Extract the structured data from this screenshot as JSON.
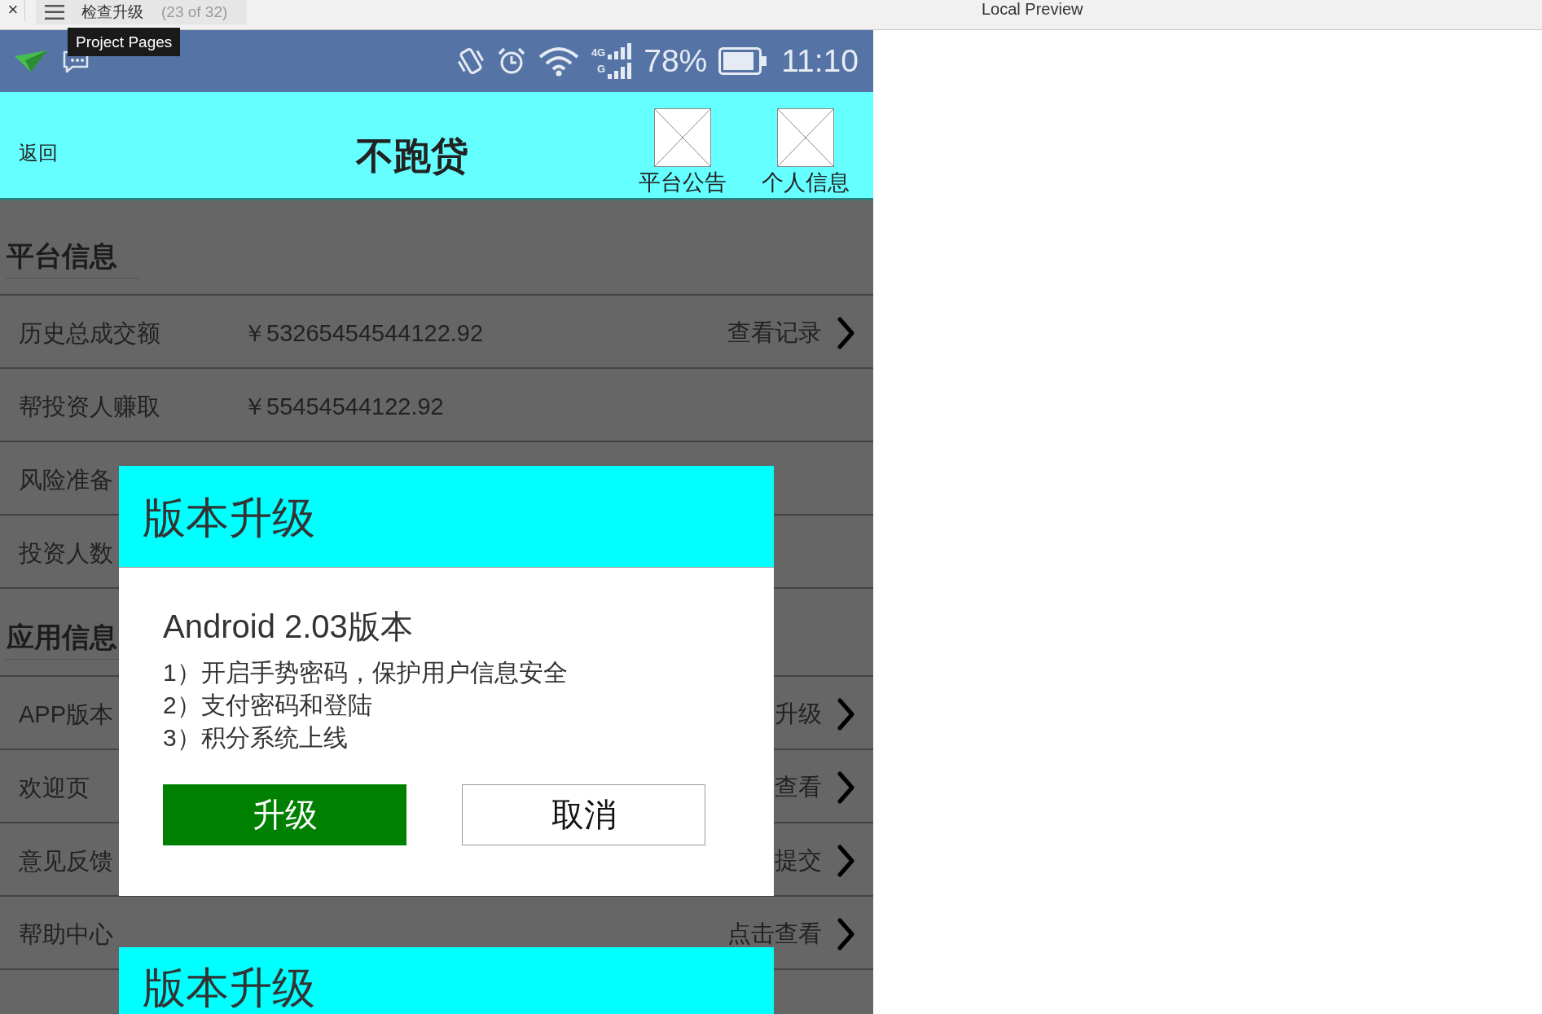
{
  "top_bar": {
    "close": "×",
    "page_tab": {
      "label": "检查升级",
      "count": "(23 of 32)"
    },
    "title": "Local Preview",
    "tooltip": "Project Pages"
  },
  "status_bar": {
    "network": [
      "4G",
      "G"
    ],
    "battery": "78%",
    "time": "11:10"
  },
  "header": {
    "back": "返回",
    "title": "不跑贷",
    "links": [
      "平台公告",
      "个人信息"
    ]
  },
  "sections": [
    {
      "heading": "平台信息",
      "rows": [
        {
          "label": "历史总成交额",
          "value": "￥53265454544122.92",
          "action": "查看记录"
        },
        {
          "label": "帮投资人赚取",
          "value": "￥55454544122.92"
        },
        {
          "label": "风险准备"
        },
        {
          "label": "投资人数"
        }
      ]
    },
    {
      "heading": "应用信息",
      "rows": [
        {
          "label": "APP版本",
          "action": "升级"
        },
        {
          "label": "欢迎页",
          "action": "查看"
        },
        {
          "label": "意见反馈",
          "action": "提交"
        },
        {
          "label": "帮助中心",
          "action": "点击查看"
        }
      ]
    }
  ],
  "dialogs": [
    {
      "title": "版本升级",
      "version": "Android 2.03版本",
      "notes": [
        "1）开启手势密码，保护用户信息安全",
        "2）支付密码和登陆",
        "3）积分系统上线"
      ],
      "buttons": [
        {
          "label": "升级",
          "kind": "primary"
        },
        {
          "label": "取消",
          "kind": "secondary"
        }
      ]
    },
    {
      "title": "版本升级"
    }
  ]
}
